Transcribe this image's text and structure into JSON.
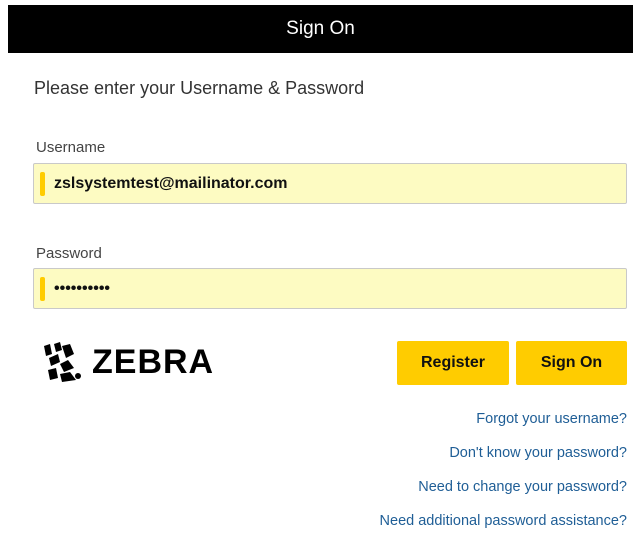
{
  "header": {
    "title": "Sign On"
  },
  "form": {
    "instruction": "Please enter your Username & Password",
    "username": {
      "label": "Username",
      "value": "zslsystemtest@mailinator.com"
    },
    "password": {
      "label": "Password",
      "value": "••••••••••"
    }
  },
  "brand": {
    "logo_text": "ZEBRA",
    "logo_icon": "zebra-head-icon"
  },
  "buttons": {
    "register": "Register",
    "sign_on": "Sign On"
  },
  "links": [
    {
      "label": "Forgot your username?"
    },
    {
      "label": "Don't know your password?"
    },
    {
      "label": "Need to change your password?"
    },
    {
      "label": "Need additional password assistance?"
    }
  ],
  "colors": {
    "header_bg": "#000000",
    "accent": "#ffcc00",
    "field_bg": "#fdfbc2",
    "link": "#1f5e96"
  }
}
